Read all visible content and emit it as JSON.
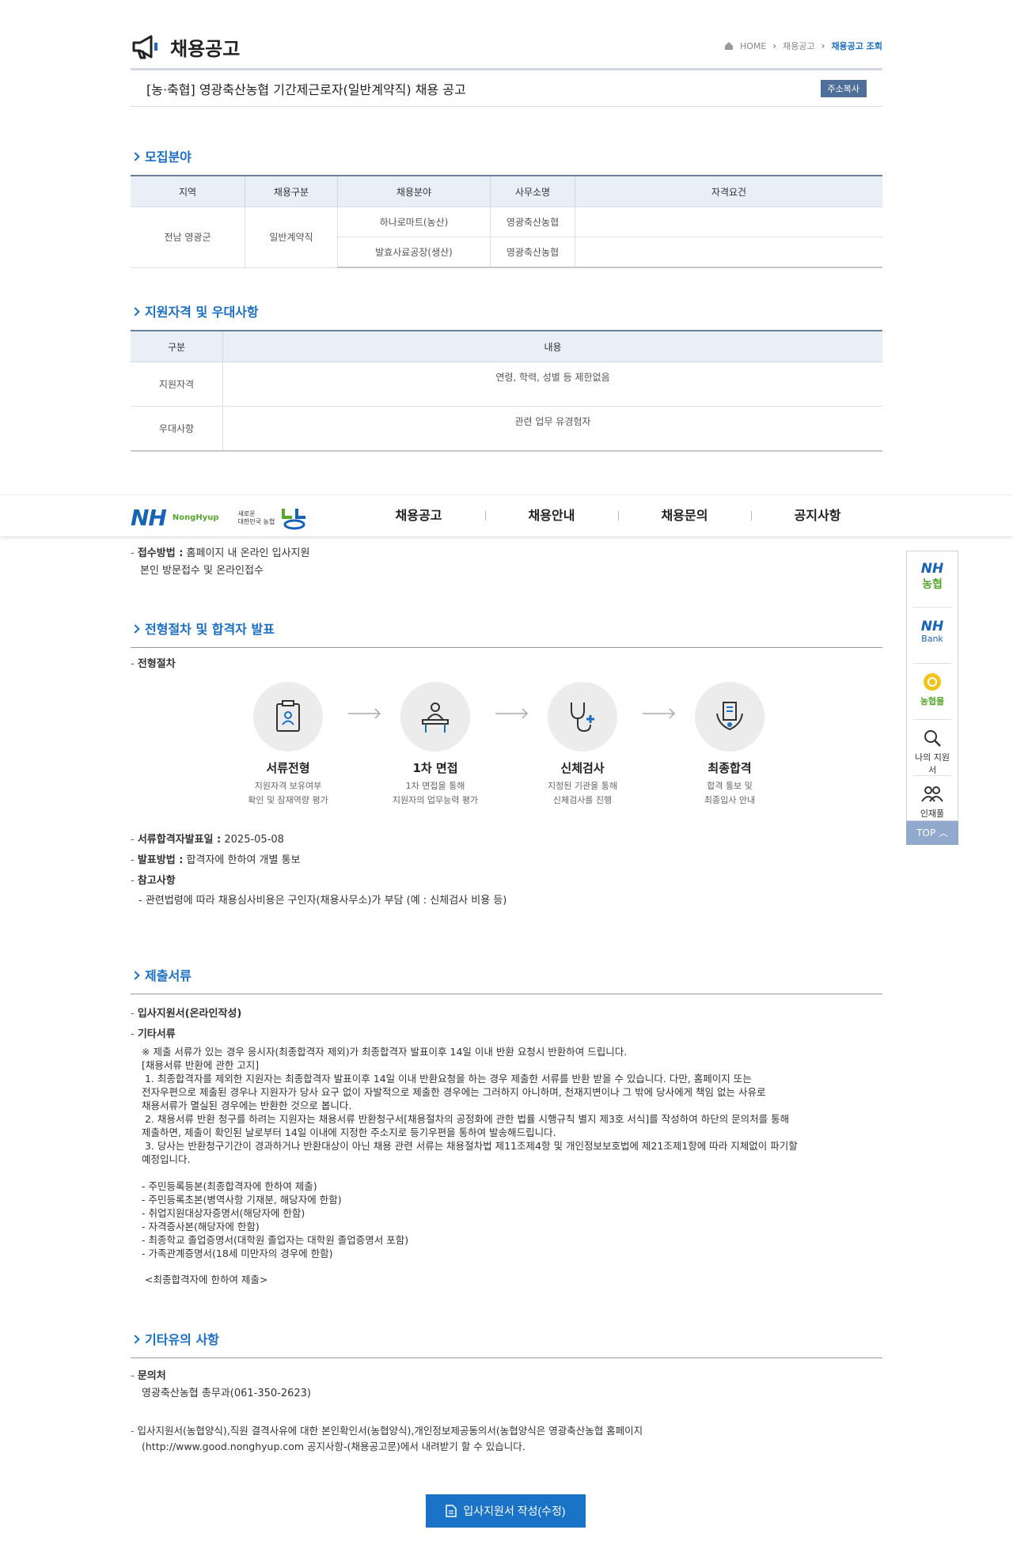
{
  "header": {
    "title": "채용공고",
    "breadcrumb": [
      "HOME",
      "채용공고",
      "채용공고 조회"
    ]
  },
  "post": {
    "title": "[농·축협] 영광축산농협 기간제근로자(일반계약직) 채용 공고",
    "copy_label": "주소복사"
  },
  "recruit": {
    "title": "모집분야",
    "headers": [
      "지역",
      "채용구분",
      "채용분야",
      "사무소명",
      "자격요건"
    ],
    "region": "전남 영광군",
    "type": "일반계약직",
    "rows": [
      {
        "field": "하나로마트(농산)",
        "office": "영광축산농협",
        "req": ""
      },
      {
        "field": "발효사료공장(생산)",
        "office": "영광축산농협",
        "req": ""
      }
    ]
  },
  "qualification": {
    "title": "지원자격 및 우대사항",
    "headers": [
      "구분",
      "내용"
    ],
    "rows": [
      {
        "k": "지원자격",
        "v": "연령, 학력, 성별 등 제한없음"
      },
      {
        "k": "우대사항",
        "v": "관련 업무 유경험자"
      }
    ]
  },
  "receipt": {
    "method_label": "접수방법 :",
    "method_value": "홈페이지 내 온라인 입사지원",
    "method_note": "본인 방문접수 및 온라인접수"
  },
  "nav": {
    "logo_main": "NH",
    "logo_sub": "NongHyup",
    "logo_tag1": "새로운",
    "logo_tag2": "대한민국 농협",
    "items": [
      "채용공고",
      "채용안내",
      "채용문의",
      "공지사항"
    ]
  },
  "quick": {
    "items": [
      {
        "l1": "NH",
        "l2": "농협"
      },
      {
        "l1": "NH",
        "l2": "Bank"
      },
      {
        "l1": "",
        "l2": "농협몰"
      },
      {
        "l1": "",
        "l2": "나의 지원서"
      },
      {
        "l1": "",
        "l2": "인재풀"
      }
    ],
    "top": "TOP"
  },
  "process": {
    "title": "전형절차 및 합격자 발표",
    "label": "전형절차",
    "steps": [
      {
        "name": "서류전형",
        "d1": "지원자격 보유여부",
        "d2": "확인 및 잠재역량 평가"
      },
      {
        "name": "1차 면접",
        "d1": "1차 면접을 통해",
        "d2": "지원자의 업무능력 평가"
      },
      {
        "name": "신체검사",
        "d1": "지정된 기관을 통해",
        "d2": "신체검사를 진행"
      },
      {
        "name": "최종합격",
        "d1": "합격 통보 및",
        "d2": "최종입사 안내"
      }
    ],
    "pass_label": "서류합격자발표일 :",
    "pass_date": "2025-05-08",
    "announce_label": "발표방법 :",
    "announce_value": "합격자에 한하여 개별 통보",
    "ref_label": "참고사항",
    "ref_value": "- 관련법령에 따라 채용심사비용은 구인자(채용사무소)가 부담 (예 : 신체검사 비용 등)"
  },
  "documents": {
    "title": "제출서류",
    "item1": "입사지원서(온라인작성)",
    "item2": "기타서류",
    "notice": "※ 제출 서류가 있는 경우 응시자(최종합격자 제외)가 최종합격자 발표이후 14일 이내 반환 요청시 반환하여 드립니다.\n[채용서류 반환에 관한 고지]\n 1. 최종합격자를 제외한 지원자는 최종합격자 발표이후 14일 이내 반환요청을 하는 경우 제출한 서류를 반환 받을 수 있습니다. 다만, 홈페이지 또는\n전자우편으로 제출된 경우나 지원자가 당사 요구 없이 자발적으로 제출한 경우에는 그러하지 아니하며, 천재지변이나 그 밖에 당사에게 책임 없는 사유로\n채용서류가 멸실된 경우에는 반환한 것으로 봅니다.\n 2. 채용서류 반환 청구를 하려는 지원자는 채용서류 반환청구서[채용절차의 공정화에 관한 법률 시행규칙 별지 제3호 서식]를 작성하여 하단의 문의처를 통해\n제출하면, 제출이 확인된 날로부터 14일 이내에 지정한 주소지로 등기우편을 통하여 발송해드립니다.\n 3. 당사는 반환청구기간이 경과하거나 반환대상이 아닌 채용 관련 서류는 채용절차법 제11조제4항 및 개인정보보호법에 제21조제1항에 따라 지체없이 파기할\n예정입니다.",
    "list": [
      "- 주민등록등본(최종합격자에 한하여 제출)",
      "- 주민등록초본(병역사항 기재분, 해당자에 한함)",
      "- 취업지원대상자증명서(해당자에 한함)",
      "- 자격증사본(해당자에 한함)",
      "- 최종학교 졸업증명서(대학원 졸업자는 대학원 졸업증명서 포함)",
      "- 가족관계증명서(18세 미만자의 경우에 한함)"
    ],
    "final_note": "<최종합격자에 한하여 제출>"
  },
  "etc": {
    "title": "기타유의 사항",
    "contact_label": "문의처",
    "contact_value": "영광축산농협 총무과(061-350-2623)",
    "note1": "입사지원서(농협양식),직원 결격사유에 대한 본인확인서(농협양식),개인정보제공동의서(농협양식은 영광축산농협 홈페이지",
    "note2": "(http://www.good.nonghyup.com 공지사항-(채용공고문)에서 내려받기 할 수 있습니다."
  },
  "apply": {
    "label": "입사지원서 작성(수정)"
  }
}
